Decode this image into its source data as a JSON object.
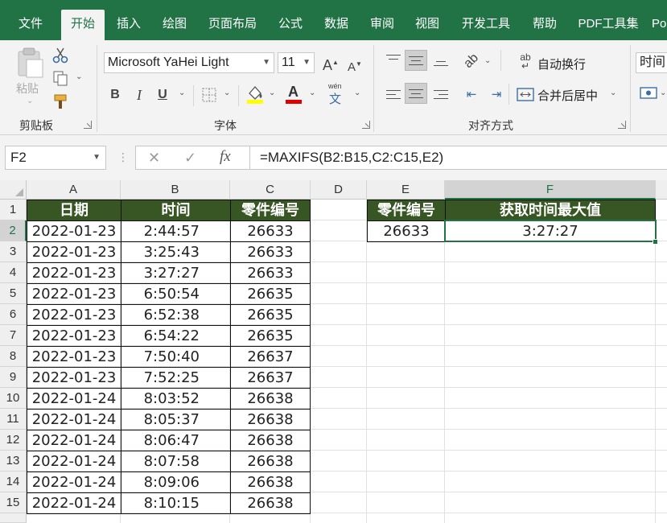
{
  "tabs": [
    {
      "label": "文件",
      "active": false
    },
    {
      "label": "开始",
      "active": true
    },
    {
      "label": "插入",
      "active": false
    },
    {
      "label": "绘图",
      "active": false
    },
    {
      "label": "页面布局",
      "active": false
    },
    {
      "label": "公式",
      "active": false
    },
    {
      "label": "数据",
      "active": false
    },
    {
      "label": "审阅",
      "active": false
    },
    {
      "label": "视图",
      "active": false
    },
    {
      "label": "开发工具",
      "active": false
    },
    {
      "label": "帮助",
      "active": false
    },
    {
      "label": "PDF工具集",
      "active": false
    },
    {
      "label": "Po",
      "active": false
    }
  ],
  "ribbon": {
    "clipboard": {
      "label": "剪贴板",
      "paste_label": "粘贴"
    },
    "font": {
      "label": "字体",
      "font_name": "Microsoft YaHei Light",
      "font_size": "11",
      "bold": "B",
      "italic": "I",
      "underline": "U",
      "grow": "A",
      "shrink": "A",
      "font_color_glyph": "A",
      "phonetic_glyph": "文",
      "phonetic_top": "wén"
    },
    "alignment": {
      "label": "对齐方式",
      "wrap_text": "自动换行",
      "merge_center": "合并后居中"
    },
    "number": {
      "format_value": "时间"
    }
  },
  "formula_bar": {
    "name_box": "F2",
    "formula": "=MAXIFS(B2:B15,C2:C15,E2)",
    "fx": "fx"
  },
  "sheet": {
    "columns": [
      "A",
      "B",
      "C",
      "D",
      "E",
      "F"
    ],
    "selected_column": "F",
    "selected_row": 2,
    "rows": [
      "1",
      "2",
      "3",
      "4",
      "5",
      "6",
      "7",
      "8",
      "9",
      "10",
      "11",
      "12",
      "13",
      "14",
      "15"
    ],
    "table_headers": [
      "日期",
      "时间",
      "零件编号"
    ],
    "table_rows": [
      [
        "2022-01-23",
        "2:44:57",
        "26633"
      ],
      [
        "2022-01-23",
        "3:25:43",
        "26633"
      ],
      [
        "2022-01-23",
        "3:27:27",
        "26633"
      ],
      [
        "2022-01-23",
        "6:50:54",
        "26635"
      ],
      [
        "2022-01-23",
        "6:52:38",
        "26635"
      ],
      [
        "2022-01-23",
        "6:54:22",
        "26635"
      ],
      [
        "2022-01-23",
        "7:50:40",
        "26637"
      ],
      [
        "2022-01-23",
        "7:52:25",
        "26637"
      ],
      [
        "2022-01-24",
        "8:03:52",
        "26638"
      ],
      [
        "2022-01-24",
        "8:05:37",
        "26638"
      ],
      [
        "2022-01-24",
        "8:06:47",
        "26638"
      ],
      [
        "2022-01-24",
        "8:07:58",
        "26638"
      ],
      [
        "2022-01-24",
        "8:09:06",
        "26638"
      ],
      [
        "2022-01-24",
        "8:10:15",
        "26638"
      ]
    ],
    "lookup_headers": [
      "零件编号",
      "获取时间最大值"
    ],
    "lookup_values": [
      "26633",
      "3:27:27"
    ]
  },
  "colors": {
    "accent": "#217346",
    "header_fill": "#375623"
  }
}
